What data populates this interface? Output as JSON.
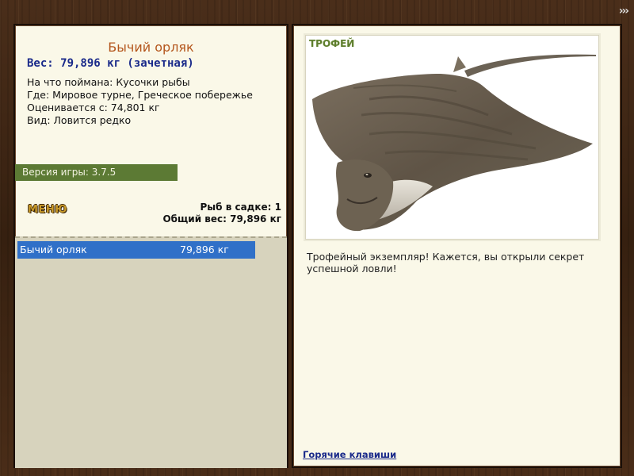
{
  "nav": {
    "forward_icon": "›››"
  },
  "fish": {
    "name": "Бычий орляк",
    "weight_line": "Вес: 79,896 кг (зачетная)",
    "caught_on": "На что поймана: Кусочки рыбы",
    "location": "Где: Мировое турне, Греческое побережье",
    "valued_from": "Оценивается с: 74,801 кг",
    "rarity": "Вид: Ловится редко"
  },
  "version": "Версия игры: 3.7.5",
  "menu_label": "МЕНЮ",
  "cage": {
    "count_line": "Рыб в садке: 1",
    "total_line": "Общий вес: 79,896 кг",
    "items": [
      {
        "name": "Бычий орляк",
        "weight": "79,896 кг",
        "selected": true
      }
    ]
  },
  "trophy": {
    "label": "ТРОФЕЙ",
    "message": "Трофейный экземпляр! Кажется, вы открыли секрет успешной ловли!"
  },
  "hotkeys_label": "Горячие клавиши",
  "colors": {
    "accent_title": "#b4561c",
    "link": "#1a2a8a",
    "version_bar": "#5c7a34",
    "selected_row": "#3070c8"
  }
}
